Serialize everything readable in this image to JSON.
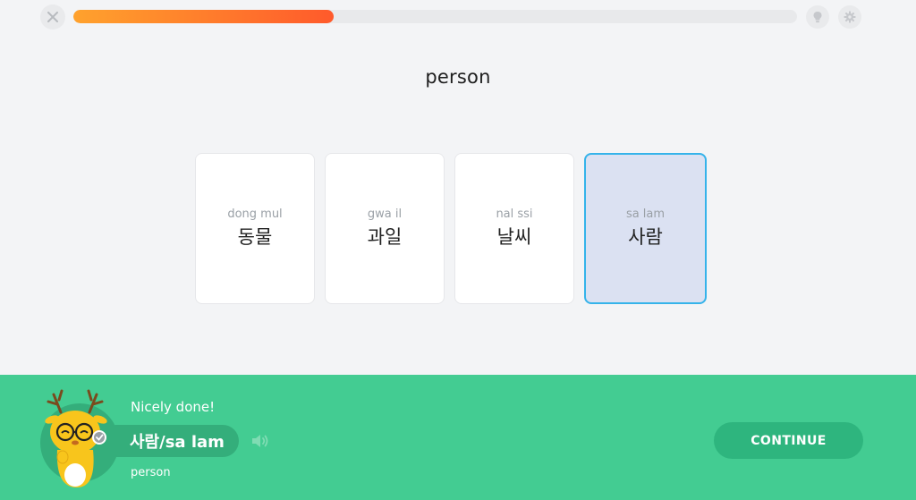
{
  "header": {
    "progress_percent": 36,
    "progress_color_start": "#ffa22d",
    "progress_color_end": "#ff5a2b",
    "close_icon": "close-icon",
    "hint_icon": "lightbulb-icon",
    "settings_icon": "gear-icon"
  },
  "question": {
    "prompt": "person"
  },
  "options": [
    {
      "romanization": "dong mul",
      "hangul": "동물",
      "selected": false
    },
    {
      "romanization": "gwa il",
      "hangul": "과일",
      "selected": false
    },
    {
      "romanization": "nal ssi",
      "hangul": "날씨",
      "selected": false
    },
    {
      "romanization": "sa lam",
      "hangul": "사람",
      "selected": true
    }
  ],
  "feedback": {
    "message": "Nicely done!",
    "answer": "사람/sa lam",
    "translation": "person",
    "continue_label": "CONTINUE",
    "speaker_icon": "speaker-icon",
    "mascot": "deer-mascot",
    "background_color": "#43cc92",
    "accent_color": "#35b3ea"
  }
}
